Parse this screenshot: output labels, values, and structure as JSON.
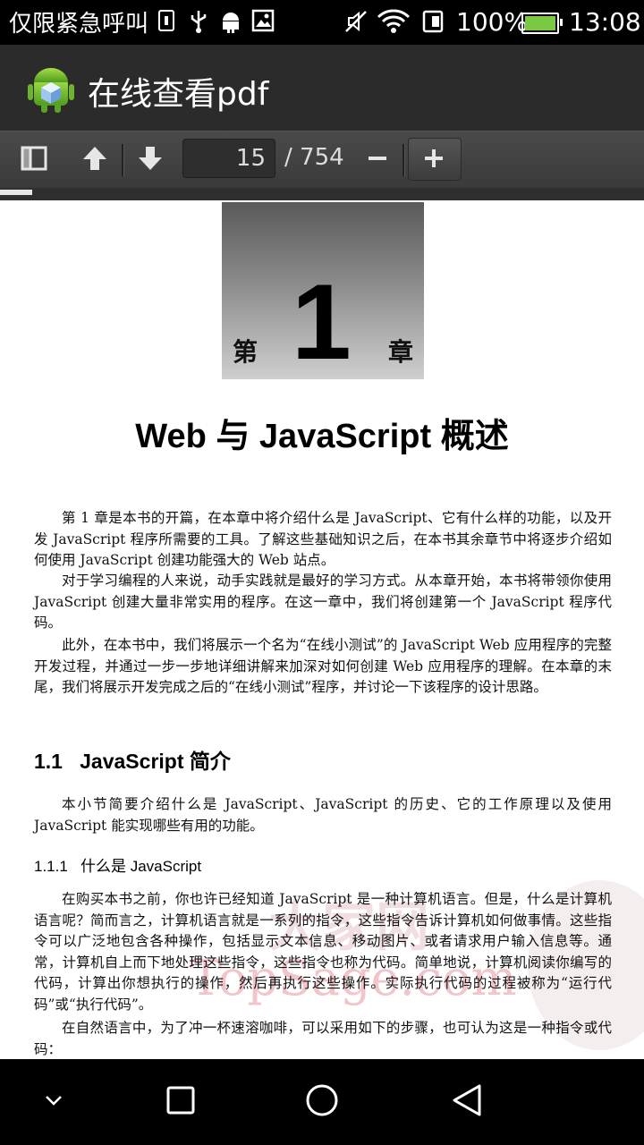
{
  "status_bar": {
    "carrier_text": "仅限紧急呼叫",
    "battery_percent": "100%",
    "time": "13:08",
    "icons": [
      "sim-icon",
      "usb-icon",
      "android-debug-icon",
      "image-icon",
      "mute-icon",
      "wifi-icon",
      "data-icon",
      "battery-icon"
    ]
  },
  "app_bar": {
    "title": "在线查看pdf",
    "logo_icon": "android-cube-icon"
  },
  "toolbar": {
    "current_page": "15",
    "total_pages": "/ 754",
    "icons": [
      "sidebar-toggle-icon",
      "page-up-icon",
      "page-down-icon",
      "zoom-out-icon",
      "zoom-in-icon"
    ],
    "read_progress": 0.05
  },
  "document": {
    "chapter_label_left": "第",
    "chapter_number": "1",
    "chapter_label_right": "章",
    "chapter_title": "Web 与 JavaScript 概述",
    "paragraphs": [
      "第 1 章是本书的开篇，在本章中将介绍什么是 JavaScript、它有什么样的功能，以及开发 JavaScript 程序所需要的工具。了解这些基础知识之后，在本书其余章节中将逐步介绍如何使用 JavaScript 创建功能强大的 Web 站点。",
      "对于学习编程的人来说，动手实践就是最好的学习方式。从本章开始，本书将带领你使用 JavaScript 创建大量非常实用的程序。在这一章中，我们将创建第一个 JavaScript 程序代码。",
      "此外，在本书中，我们将展示一个名为“在线小测试”的 JavaScript Web 应用程序的完整开发过程，并通过一步一步地详细讲解来加深对如何创建 Web 应用程序的理解。在本章的末尾，我们将展示开发完成之后的“在线小测试”程序，并讨论一下该程序的设计思路。"
    ],
    "section_heading": "1.1   JavaScript 简介",
    "section_intro": "本小节简要介绍什么是 JavaScript、JavaScript 的历史、它的工作原理以及使用 JavaScript 能实现哪些有用的功能。",
    "subsection_heading": "1.1.1   什么是 JavaScript",
    "subsection_paragraphs": [
      "在购买本书之前，你也许已经知道 JavaScript 是一种计算机语言。但是，什么是计算机语言呢？简而言之，计算机语言就是一系列的指令，这些指令告诉计算机如何做事情。这些指令可以广泛地包含各种操作，包括显示文本信息、移动图片、或者请求用户输入信息等。通常，计算机自上而下地处理这些指令，这些指令也称为代码。简单地说，计算机阅读你编写的代码，计算出你想执行的操作，然后再执行这些操作。实际执行代码的过程被称为“运行代码”或“执行代码”。",
      "在自然语言中，为了冲一杯速溶咖啡，可以采用如下的步骤，也可认为这是一种指令或代码："
    ],
    "watermark_text": "TopSage.com",
    "watermark_cn": "大家网"
  },
  "nav_bar": {
    "icons": [
      "hide-keyboard-icon",
      "recents-icon",
      "home-icon",
      "back-icon"
    ]
  }
}
